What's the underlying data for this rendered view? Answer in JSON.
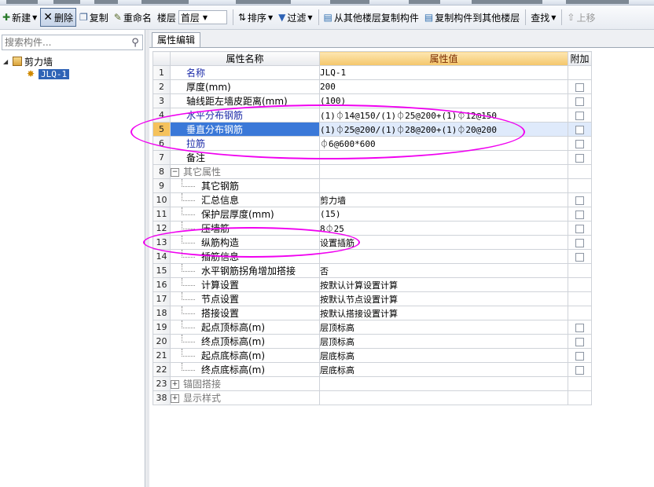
{
  "toolbar": {
    "new_label": "新建",
    "delete_label": "删除",
    "copy_label": "复制",
    "rename_label": "重命名",
    "floor_label": "楼层",
    "floor_value": "首层",
    "sort_label": "排序",
    "filter_label": "过滤",
    "copy_from_floor_label": "从其他楼层复制构件",
    "copy_to_floor_label": "复制构件到其他楼层",
    "find_label": "查找",
    "move_up_label": "上移"
  },
  "left": {
    "search_placeholder": "搜索构件...",
    "tree": {
      "root_label": "剪力墙",
      "child_label": "JLQ-1"
    }
  },
  "tab_label": "属性编辑",
  "grid": {
    "headers": {
      "name": "属性名称",
      "value": "属性值",
      "attach": "附加"
    },
    "rows": [
      {
        "num": "1",
        "name": "名称",
        "value": "JLQ-1",
        "style": "blue",
        "cb": false
      },
      {
        "num": "2",
        "name": "厚度(mm)",
        "value": "200",
        "style": "plain",
        "cb": true
      },
      {
        "num": "3",
        "name": "轴线距左墙皮距离(mm)",
        "value": "(100)",
        "style": "plain",
        "cb": true
      },
      {
        "num": "4",
        "name": "水平分布钢筋",
        "value": "(1)⏀14@150/(1)⏀25@200+(1)⏀12@150",
        "style": "blue",
        "cb": true
      },
      {
        "num": "5",
        "name": "垂直分布钢筋",
        "value": "(1)⏀25@200/(1)⏀28@200+(1)⏀20@200",
        "style": "blue",
        "cb": true,
        "selected": true
      },
      {
        "num": "6",
        "name": "拉筋",
        "value": "⏀6@600*600",
        "style": "blue",
        "cb": true
      },
      {
        "num": "7",
        "name": "备注",
        "value": "",
        "style": "plain",
        "cb": true
      },
      {
        "num": "8",
        "name": "其它属性",
        "value": "",
        "style": "group",
        "cb": false,
        "expander": "−"
      },
      {
        "num": "9",
        "name": "其它钢筋",
        "value": "",
        "style": "sub",
        "cb": false
      },
      {
        "num": "10",
        "name": "汇总信息",
        "value": "剪力墙",
        "style": "sub",
        "cb": true
      },
      {
        "num": "11",
        "name": "保护层厚度(mm)",
        "value": "(15)",
        "style": "sub",
        "cb": true
      },
      {
        "num": "12",
        "name": "压墙筋",
        "value": "8⏀25",
        "style": "sub",
        "cb": true
      },
      {
        "num": "13",
        "name": "纵筋构造",
        "value": "设置插筋",
        "style": "sub",
        "cb": true
      },
      {
        "num": "14",
        "name": "插筋信息",
        "value": "",
        "style": "sub",
        "cb": true
      },
      {
        "num": "15",
        "name": "水平钢筋拐角增加搭接",
        "value": "否",
        "style": "sub",
        "cb": false
      },
      {
        "num": "16",
        "name": "计算设置",
        "value": "按默认计算设置计算",
        "style": "sub",
        "cb": false
      },
      {
        "num": "17",
        "name": "节点设置",
        "value": "按默认节点设置计算",
        "style": "sub",
        "cb": false
      },
      {
        "num": "18",
        "name": "搭接设置",
        "value": "按默认搭接设置计算",
        "style": "sub",
        "cb": false
      },
      {
        "num": "19",
        "name": "起点顶标高(m)",
        "value": "层顶标高",
        "style": "sub",
        "cb": true
      },
      {
        "num": "20",
        "name": "终点顶标高(m)",
        "value": "层顶标高",
        "style": "sub",
        "cb": true
      },
      {
        "num": "21",
        "name": "起点底标高(m)",
        "value": "层底标高",
        "style": "sub",
        "cb": true
      },
      {
        "num": "22",
        "name": "终点底标高(m)",
        "value": "层底标高",
        "style": "sub",
        "cb": true
      },
      {
        "num": "23",
        "name": "锚固搭接",
        "value": "",
        "style": "group",
        "cb": false,
        "expander": "+"
      },
      {
        "num": "38",
        "name": "显示样式",
        "value": "",
        "style": "group",
        "cb": false,
        "expander": "+"
      }
    ]
  }
}
